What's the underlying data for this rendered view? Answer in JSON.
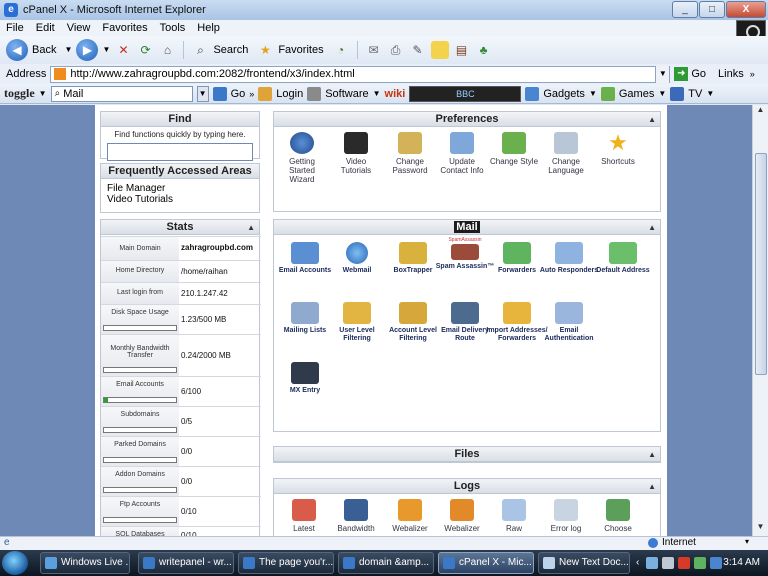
{
  "window": {
    "title": "cPanel X - Microsoft Internet Explorer",
    "buttons": [
      "_",
      "□",
      "X"
    ]
  },
  "menu": [
    "File",
    "Edit",
    "View",
    "Favorites",
    "Tools",
    "Help"
  ],
  "toolbar": {
    "back": "Back",
    "search": "Search",
    "favorites": "Favorites"
  },
  "address": {
    "label": "Address",
    "url": "http://www.zahragroupbd.com:2082/frontend/x3/index.html",
    "go": "Go",
    "links": "Links"
  },
  "togglebar": {
    "logo": "toggle",
    "search_value": "Mail",
    "go": "Go",
    "login": "Login",
    "software": "Software",
    "wiki": "wiki",
    "media": "BBC",
    "gadgets": "Gadgets",
    "games": "Games",
    "tv": "TV"
  },
  "find": {
    "title": "Find",
    "hint": "Find functions quickly by typing here."
  },
  "faa": {
    "title": "Frequently Accessed Areas",
    "items": [
      "File Manager",
      "Video Tutorials"
    ]
  },
  "stats": {
    "title": "Stats",
    "rows": [
      {
        "label": "Main Domain",
        "value": "zahragroupbd.com"
      },
      {
        "label": "Home Directory",
        "value": "/home/raihan"
      },
      {
        "label": "Last login from",
        "value": "210.1.247.42"
      },
      {
        "label": "Disk Space Usage",
        "value": "1.23/500 MB"
      },
      {
        "label": "Monthly Bandwidth Transfer",
        "value": "0.24/2000 MB"
      },
      {
        "label": "Email Accounts",
        "value": "6/100"
      },
      {
        "label": "Subdomains",
        "value": "0/5"
      },
      {
        "label": "Parked Domains",
        "value": "0/0"
      },
      {
        "label": "Addon Domains",
        "value": "0/0"
      },
      {
        "label": "Ftp Accounts",
        "value": "0/10"
      },
      {
        "label": "SQL Databases",
        "value": "0/10"
      }
    ],
    "email_usage_fraction": 0.06
  },
  "preferences": {
    "title": "Preferences",
    "items": [
      "Getting Started Wizard",
      "Video Tutorials",
      "Change Password",
      "Update Contact Info",
      "Change Style",
      "Change Language",
      "Shortcuts"
    ]
  },
  "mail": {
    "title": "Mail",
    "items": [
      "Email Accounts",
      "Webmail",
      "BoxTrapper",
      "Spam Assassin™",
      "Forwarders",
      "Auto Responders",
      "Default Address",
      "Mailing Lists",
      "User Level Filtering",
      "Account Level Filtering",
      "Email Delivery Route",
      "Import Addresses/ Forwarders",
      "Email Authentication",
      "MX Entry"
    ],
    "spam_badge": "SpamAssassin"
  },
  "files": {
    "title": "Files"
  },
  "logs": {
    "title": "Logs",
    "items": [
      "Latest",
      "Bandwidth",
      "Webalizer",
      "Webalizer",
      "Raw",
      "Error log",
      "Choose"
    ]
  },
  "status": {
    "zone": "Internet"
  },
  "taskbar": {
    "items": [
      "Windows Live ...",
      "writepanel - wr...",
      "The page you'r...",
      "domain &amp...",
      "cPanel X - Mic...",
      "New Text Doc..."
    ],
    "clock": "3:14 AM"
  },
  "colors": {
    "page_bg": "#6f89b6",
    "icon_blue": "#2f6fc9",
    "accent_green": "#29a329"
  }
}
